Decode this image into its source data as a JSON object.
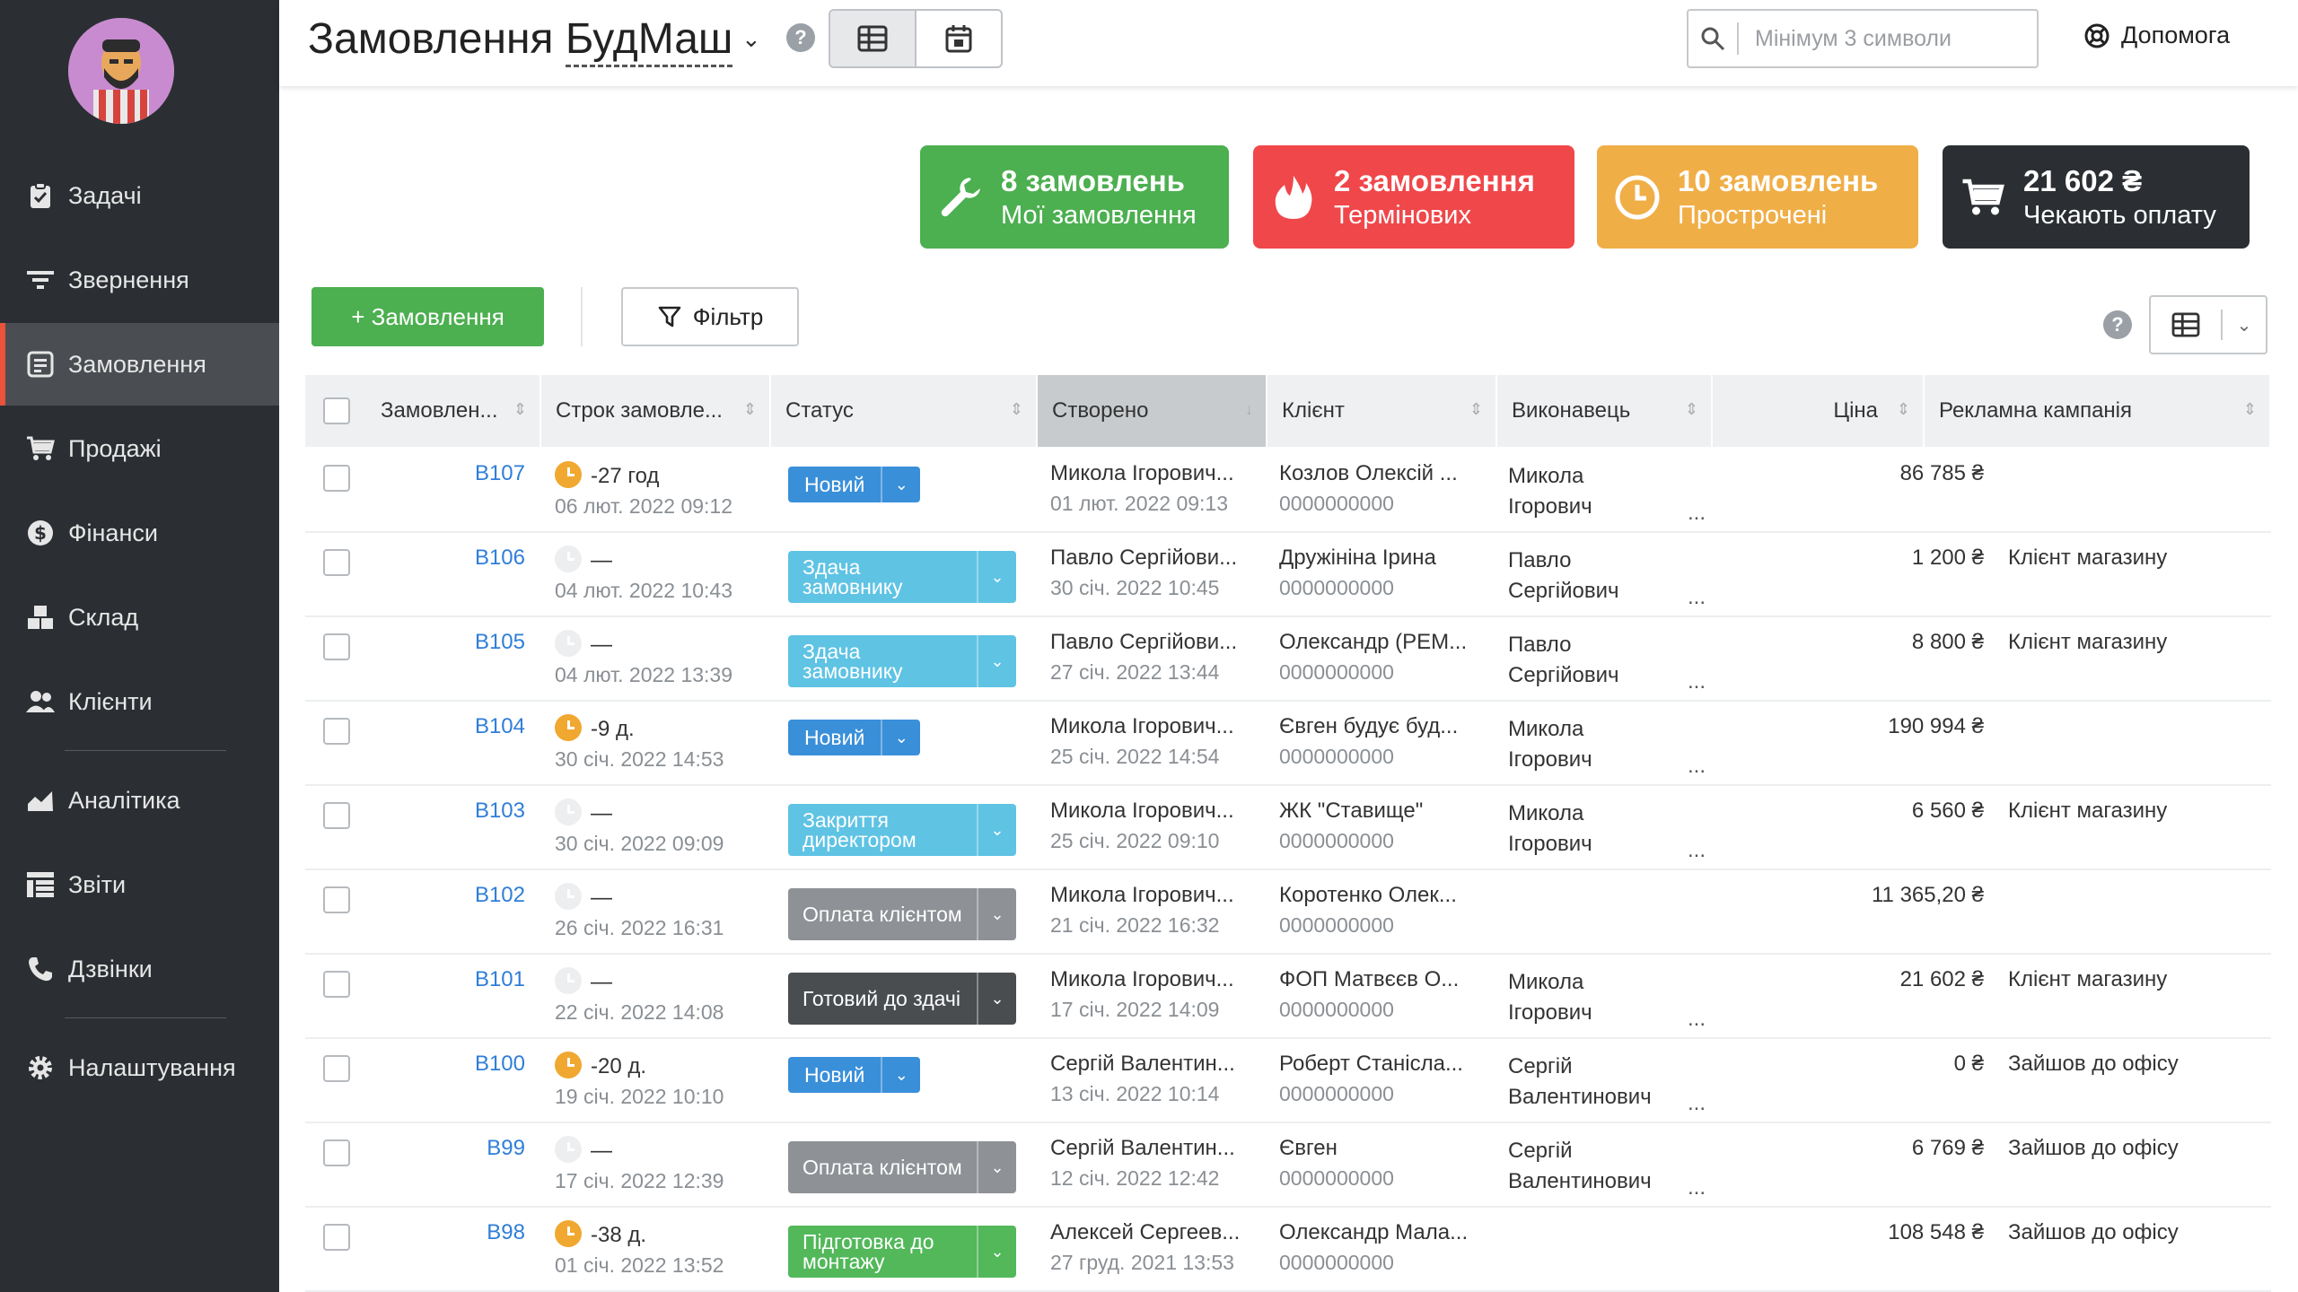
{
  "header": {
    "title": "Замовлення",
    "company": "БудМаш",
    "search_placeholder": "Мінімум 3 символи",
    "help_label": "Допомога",
    "help_q": "?"
  },
  "sidebar": {
    "items": [
      {
        "label": "Задачі",
        "icon": "clipboard-icon"
      },
      {
        "label": "Звернення",
        "icon": "filter-lines-icon"
      },
      {
        "label": "Замовлення",
        "icon": "order-icon",
        "active": true
      },
      {
        "label": "Продажі",
        "icon": "cart-icon"
      },
      {
        "label": "Фінанси",
        "icon": "dollar-icon"
      },
      {
        "label": "Склад",
        "icon": "boxes-icon"
      },
      {
        "label": "Клієнти",
        "icon": "users-icon"
      },
      {
        "label": "Аналітика",
        "icon": "chart-icon"
      },
      {
        "label": "Звіти",
        "icon": "list-icon"
      },
      {
        "label": "Дзвінки",
        "icon": "phone-icon"
      },
      {
        "label": "Налаштування",
        "icon": "gear-icon"
      }
    ]
  },
  "cards": [
    {
      "title": "8 замовлень",
      "subtitle": "Мої замовлення",
      "color": "#4caf50",
      "icon": "wrench-icon"
    },
    {
      "title": "2 замовлення",
      "subtitle": "Термінових",
      "color": "#f0474a",
      "icon": "fire-icon"
    },
    {
      "title": "10 замовлень",
      "subtitle": "Прострочені",
      "color": "#f0ae47",
      "icon": "clock-icon"
    },
    {
      "title": "21 602 ₴",
      "subtitle": "Чекають оплату",
      "color": "#2b2f33",
      "icon": "cart-icon"
    }
  ],
  "toolbar": {
    "add_label": "+ Замовлення",
    "filter_label": "Фільтр",
    "help_q": "?"
  },
  "table": {
    "columns": [
      "Замовлен...",
      "Строк замовле...",
      "Статус",
      "Створено",
      "Клієнт",
      "Виконавець",
      "Ціна",
      "Рекламна кампанія"
    ],
    "rows": [
      {
        "num": "B107",
        "deadline": "-27 год",
        "deadline_date": "06 лют. 2022 09:12",
        "clock": "orange",
        "status": "Новий",
        "status_color": "b-blue",
        "two_line": false,
        "creator": "Микола Ігорович...",
        "created": "01 лют. 2022 09:13",
        "client": "Козлов Олексій ...",
        "phone": "0000000000",
        "exec1": "Микола",
        "exec2": "Ігорович",
        "dots": "...",
        "price": "86 785 ₴",
        "campaign": ""
      },
      {
        "num": "B106",
        "deadline": "—",
        "deadline_date": "04 лют. 2022 10:43",
        "clock": "grey",
        "status": "Здача замовнику",
        "status_color": "b-cyan",
        "two_line": true,
        "creator": "Павло Сергійови...",
        "created": "30 січ. 2022 10:45",
        "client": "Дружініна Ірина",
        "phone": "0000000000",
        "exec1": "Павло",
        "exec2": "Сергійович",
        "dots": "...",
        "price": "1 200 ₴",
        "campaign": "Клієнт магазину"
      },
      {
        "num": "B105",
        "deadline": "—",
        "deadline_date": "04 лют. 2022 13:39",
        "clock": "grey",
        "status": "Здача замовнику",
        "status_color": "b-cyan",
        "two_line": true,
        "creator": "Павло Сергійови...",
        "created": "27 січ. 2022 13:44",
        "client": "Олександр (РЕМ...",
        "phone": "0000000000",
        "exec1": "Павло",
        "exec2": "Сергійович",
        "dots": "...",
        "price": "8 800 ₴",
        "campaign": "Клієнт магазину"
      },
      {
        "num": "B104",
        "deadline": "-9 д.",
        "deadline_date": "30 січ. 2022 14:53",
        "clock": "orange",
        "status": "Новий",
        "status_color": "b-blue",
        "two_line": false,
        "creator": "Микола Ігорович...",
        "created": "25 січ. 2022 14:54",
        "client": "Євген будує буд...",
        "phone": "0000000000",
        "exec1": "Микола",
        "exec2": "Ігорович",
        "dots": "...",
        "price": "190 994 ₴",
        "campaign": ""
      },
      {
        "num": "B103",
        "deadline": "—",
        "deadline_date": "30 січ. 2022 09:09",
        "clock": "grey",
        "status": "Закриття директором",
        "status_color": "b-cyan",
        "two_line": true,
        "creator": "Микола Ігорович...",
        "created": "25 січ. 2022 09:10",
        "client": "ЖК \"Ставище\"",
        "phone": "0000000000",
        "exec1": "Микола",
        "exec2": "Ігорович",
        "dots": "...",
        "price": "6 560 ₴",
        "campaign": "Клієнт магазину"
      },
      {
        "num": "B102",
        "deadline": "—",
        "deadline_date": "26 січ. 2022 16:31",
        "clock": "grey",
        "status": "Оплата клієнтом",
        "status_color": "b-grey",
        "two_line": true,
        "creator": "Микола Ігорович...",
        "created": "21 січ. 2022 16:32",
        "client": "Коротенко Олек...",
        "phone": "0000000000",
        "exec1": "",
        "exec2": "",
        "dots": "",
        "price": "11 365,20 ₴",
        "campaign": ""
      },
      {
        "num": "B101",
        "deadline": "—",
        "deadline_date": "22 січ. 2022 14:08",
        "clock": "grey",
        "status": "Готовий до здачі",
        "status_color": "b-dark",
        "two_line": true,
        "creator": "Микола Ігорович...",
        "created": "17 січ. 2022 14:09",
        "client": "ФОП Матвєєв О...",
        "phone": "0000000000",
        "exec1": "Микола",
        "exec2": "Ігорович",
        "dots": "...",
        "price": "21 602 ₴",
        "campaign": "Клієнт магазину"
      },
      {
        "num": "B100",
        "deadline": "-20 д.",
        "deadline_date": "19 січ. 2022 10:10",
        "clock": "orange",
        "status": "Новий",
        "status_color": "b-blue",
        "two_line": false,
        "creator": "Сергій Валентин...",
        "created": "13 січ. 2022 10:14",
        "client": "Роберт Станісла...",
        "phone": "0000000000",
        "exec1": "Сергій",
        "exec2": "Валентинович",
        "dots": "...",
        "price": "0 ₴",
        "campaign": "Зайшов до офісу"
      },
      {
        "num": "B99",
        "deadline": "—",
        "deadline_date": "17 січ. 2022 12:39",
        "clock": "grey",
        "status": "Оплата клієнтом",
        "status_color": "b-grey",
        "two_line": true,
        "creator": "Сергій Валентин...",
        "created": "12 січ. 2022 12:42",
        "client": "Євген",
        "phone": "0000000000",
        "exec1": "Сергій",
        "exec2": "Валентинович",
        "dots": "...",
        "price": "6 769 ₴",
        "campaign": "Зайшов до офісу"
      },
      {
        "num": "B98",
        "deadline": "-38 д.",
        "deadline_date": "01 січ. 2022 13:52",
        "clock": "orange",
        "status": "Підготовка до монтажу",
        "status_color": "b-green",
        "two_line": true,
        "creator": "Алексей Сергеев...",
        "created": "27 груд. 2021 13:53",
        "client": "Олександр Мала...",
        "phone": "0000000000",
        "exec1": "",
        "exec2": "",
        "dots": "",
        "price": "108 548 ₴",
        "campaign": "Зайшов до офісу"
      }
    ]
  }
}
